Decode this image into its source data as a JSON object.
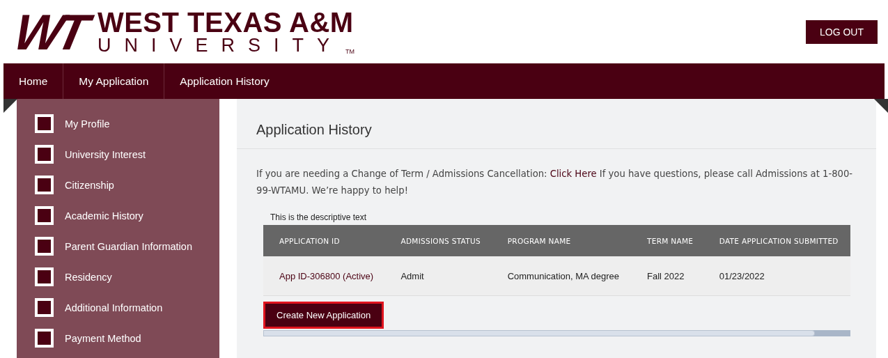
{
  "logo": {
    "mark": "WT",
    "name": "WEST TEXAS A&M",
    "subtitle": "UNIVERSITY",
    "trademark": "TM"
  },
  "logout": "LOG OUT",
  "nav": [
    "Home",
    "My Application",
    "Application History"
  ],
  "sidebar": {
    "items": [
      {
        "label": "My Profile",
        "checked": false
      },
      {
        "label": "University Interest",
        "checked": false
      },
      {
        "label": "Citizenship",
        "checked": false
      },
      {
        "label": "Academic History",
        "checked": false
      },
      {
        "label": "Parent Guardian Information",
        "checked": false
      },
      {
        "label": "Residency",
        "checked": false
      },
      {
        "label": "Additional Information",
        "checked": false
      },
      {
        "label": "Payment Method",
        "checked": false
      }
    ]
  },
  "panel": {
    "title": "Application History",
    "intro": {
      "before": "If you are needing a Change of Term / Admissions Cancellation: ",
      "link": "Click Here",
      "after": "  If you have questions, please call Admissions at 1-800-99-WTAMU. We’re happy to help!"
    },
    "caption": "This is the descriptive text",
    "table": {
      "columns": [
        "APPLICATION ID",
        "ADMISSIONS STATUS",
        "PROGRAM NAME",
        "TERM NAME",
        "DATE APPLICATION SUBMITTED"
      ],
      "rows": [
        [
          "App ID-306800 (Active)",
          "Admit",
          "Communication, MA degree",
          "Fall 2022",
          "01/23/2022"
        ]
      ]
    },
    "button": "Create New Application"
  }
}
